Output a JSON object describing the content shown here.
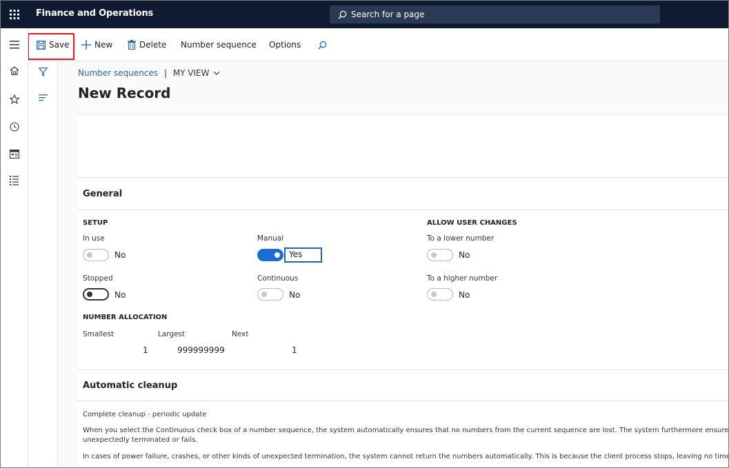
{
  "app": {
    "title": "Finance and Operations"
  },
  "search": {
    "placeholder": "Search for a page"
  },
  "actions": {
    "save": "Save",
    "new": "New",
    "delete": "Delete",
    "number_sequence": "Number sequence",
    "options": "Options"
  },
  "left_rail": {
    "icons": [
      "menu-icon",
      "home-icon",
      "star-icon",
      "recent-icon",
      "workspace-icon",
      "modules-icon"
    ]
  },
  "breadcrumb": {
    "link": "Number sequences",
    "separator": "|",
    "view": "MY VIEW"
  },
  "page": {
    "title": "New Record"
  },
  "general": {
    "heading": "General",
    "setup": {
      "heading": "SETUP",
      "in_use": {
        "label": "In use",
        "value": "No",
        "state": "off"
      },
      "manual": {
        "label": "Manual",
        "value": "Yes",
        "state": "on"
      },
      "stopped": {
        "label": "Stopped",
        "value": "No",
        "state": "off"
      },
      "continuous": {
        "label": "Continuous",
        "value": "No",
        "state": "off"
      }
    },
    "allow_user_changes": {
      "heading": "ALLOW USER CHANGES",
      "lower": {
        "label": "To a lower number",
        "value": "No",
        "state": "off"
      },
      "higher": {
        "label": "To a higher number",
        "value": "No",
        "state": "off"
      }
    },
    "number_allocation": {
      "heading": "NUMBER ALLOCATION",
      "smallest_label": "Smallest",
      "largest_label": "Largest",
      "next_label": "Next",
      "smallest": "1",
      "largest": "999999999",
      "next": "1"
    }
  },
  "cleanup": {
    "heading": "Automatic cleanup",
    "subtitle": "Complete cleanup - periodic update",
    "para1_line1": "When you select the Continuous check box of a number sequence, the system automatically ensures that no numbers from the current sequence are lost. The system furthermore ensures t",
    "para1_line2": "unexpectedly terminated or fails.",
    "para2": "In cases of power failure, crashes, or other kinds of unexpected termination, the system cannot return the numbers automatically. This is because the client process stops, leaving no time fo"
  },
  "colors": {
    "topbar": "#0f1b30",
    "accent": "#1a6fd6",
    "highlight": "#e3141b",
    "link": "#2266b3"
  }
}
